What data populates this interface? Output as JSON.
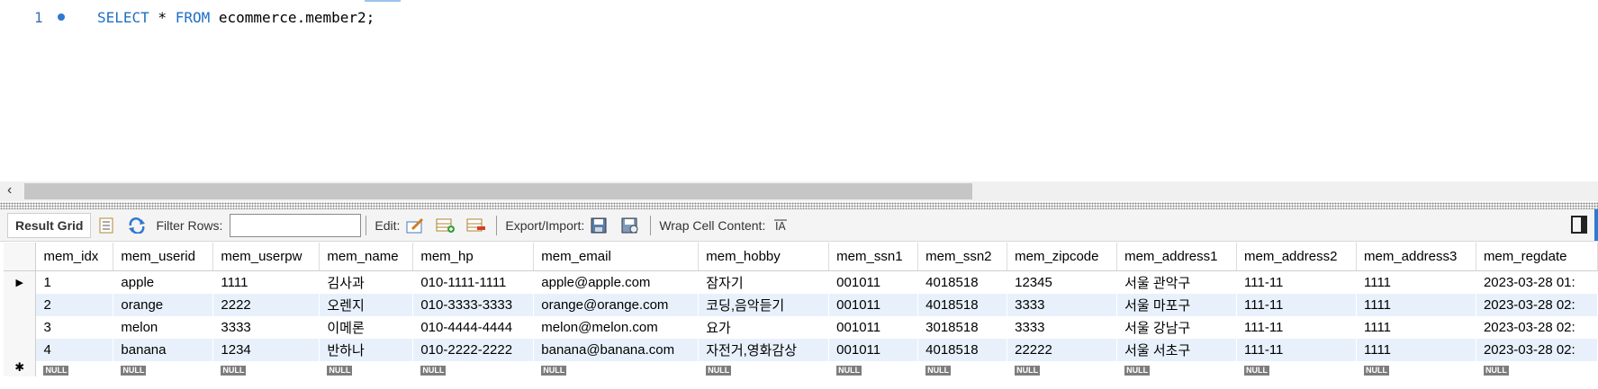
{
  "editor": {
    "line_number": "1",
    "tokens": {
      "select": "SELECT",
      "star": " * ",
      "from": "FROM",
      "rest": " ecommerce.member2;"
    }
  },
  "toolbar": {
    "result_grid": "Result Grid",
    "filter_rows": "Filter Rows:",
    "filter_value": "",
    "edit": "Edit:",
    "export_import": "Export/Import:",
    "wrap_cell": "Wrap Cell Content:"
  },
  "grid": {
    "columns": [
      "mem_idx",
      "mem_userid",
      "mem_userpw",
      "mem_name",
      "mem_hp",
      "mem_email",
      "mem_hobby",
      "mem_ssn1",
      "mem_ssn2",
      "mem_zipcode",
      "mem_address1",
      "mem_address2",
      "mem_address3",
      "mem_regdate"
    ],
    "rows": [
      [
        "1",
        "apple",
        "1111",
        "김사과",
        "010-1111-1111",
        "apple@apple.com",
        "잠자기",
        "001011",
        "4018518",
        "12345",
        "서울 관악구",
        "111-11",
        "1111",
        "2023-03-28 01:"
      ],
      [
        "2",
        "orange",
        "2222",
        "오렌지",
        "010-3333-3333",
        "orange@orange.com",
        "코딩,음악듣기",
        "001011",
        "4018518",
        "3333",
        "서울 마포구",
        "111-11",
        "1111",
        "2023-03-28 02:"
      ],
      [
        "3",
        "melon",
        "3333",
        "이메론",
        "010-4444-4444",
        "melon@melon.com",
        "요가",
        "001011",
        "3018518",
        "3333",
        "서울 강남구",
        "111-11",
        "1111",
        "2023-03-28 02:"
      ],
      [
        "4",
        "banana",
        "1234",
        "반하나",
        "010-2222-2222",
        "banana@banana.com",
        "자전거,영화감상",
        "001011",
        "4018518",
        "22222",
        "서울 서초구",
        "111-11",
        "1111",
        "2023-03-28 02:"
      ]
    ],
    "null_label": "NULL",
    "current_row_marker": "▶",
    "new_row_marker": "✱"
  }
}
